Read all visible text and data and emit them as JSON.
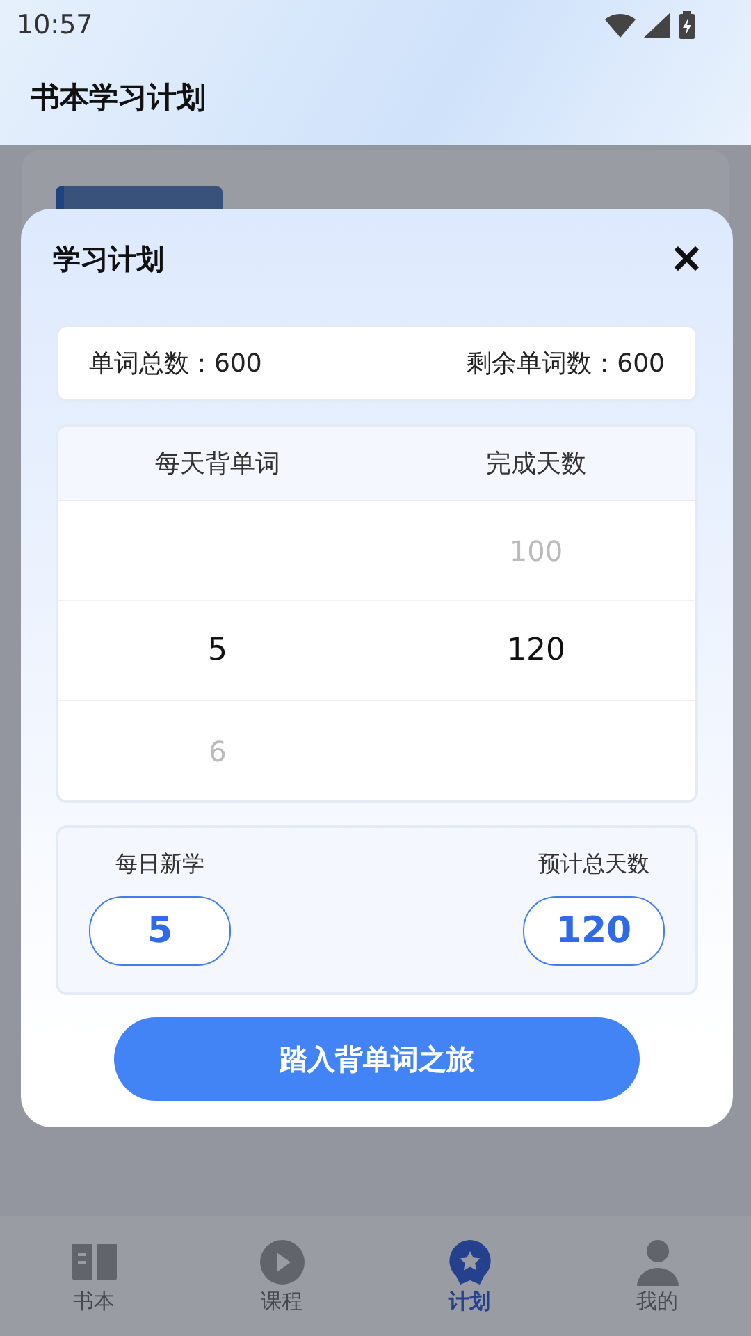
{
  "status_bar": {
    "time": "10:57"
  },
  "header": {
    "title": "书本学习计划"
  },
  "dialog": {
    "title": "学习计划",
    "close": "✕",
    "summary": {
      "total": "单词总数：600",
      "remaining": "剩余单词数：600"
    },
    "picker": {
      "columns": [
        "每天背单词",
        "完成天数"
      ],
      "rows": [
        {
          "selected": false,
          "days": "100"
        },
        {
          "selected": true,
          "words": "5",
          "days": "120"
        },
        {
          "selected": false,
          "words": "6"
        }
      ]
    },
    "result": {
      "daily_label": "每日新学",
      "daily_value": "5",
      "days_label": "预计总天数",
      "days_value": "120"
    },
    "start_button": "踏入背单词之旅"
  },
  "tabs": [
    {
      "label": "书本",
      "kind": "book",
      "selected": false
    },
    {
      "label": "课程",
      "kind": "play",
      "selected": false
    },
    {
      "label": "计划",
      "kind": "badge",
      "selected": true
    },
    {
      "label": "我的",
      "kind": "user",
      "selected": false
    }
  ]
}
